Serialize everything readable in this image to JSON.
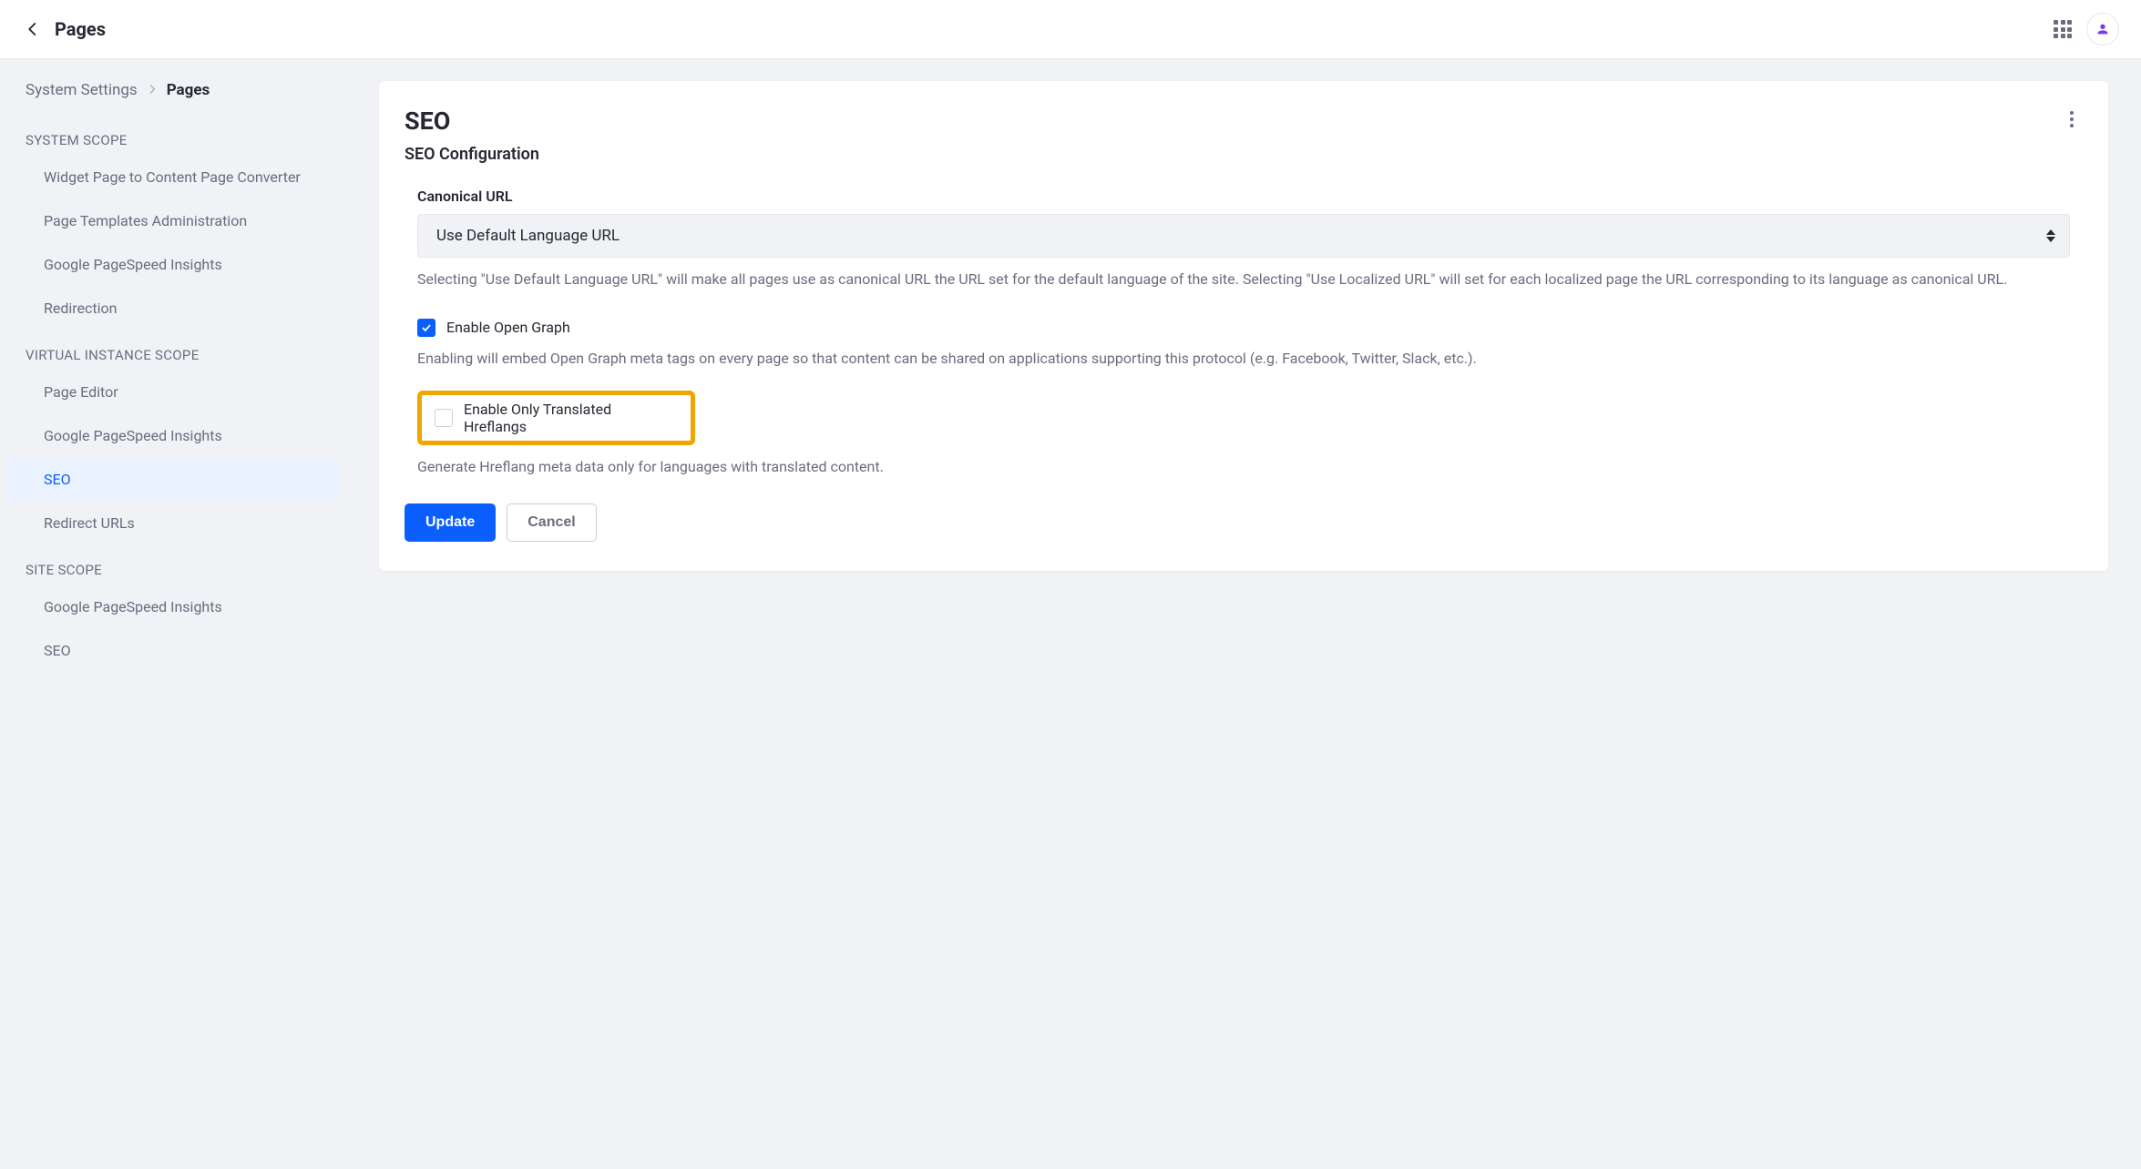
{
  "topbar": {
    "title": "Pages"
  },
  "breadcrumb": {
    "parent": "System Settings",
    "current": "Pages"
  },
  "sidebar": {
    "scopes": [
      {
        "label": "SYSTEM SCOPE",
        "items": [
          {
            "label": "Widget Page to Content Page Converter"
          },
          {
            "label": "Page Templates Administration"
          },
          {
            "label": "Google PageSpeed Insights"
          },
          {
            "label": "Redirection"
          }
        ]
      },
      {
        "label": "VIRTUAL INSTANCE SCOPE",
        "items": [
          {
            "label": "Page Editor"
          },
          {
            "label": "Google PageSpeed Insights"
          },
          {
            "label": "SEO",
            "active": true
          },
          {
            "label": "Redirect URLs"
          }
        ]
      },
      {
        "label": "SITE SCOPE",
        "items": [
          {
            "label": "Google PageSpeed Insights"
          },
          {
            "label": "SEO"
          }
        ]
      }
    ]
  },
  "panel": {
    "title": "SEO",
    "subtitle": "SEO Configuration",
    "canonical": {
      "label": "Canonical URL",
      "value": "Use Default Language URL",
      "help": "Selecting \"Use Default Language URL\" will make all pages use as canonical URL the URL set for the default language of the site. Selecting \"Use Localized URL\" will set for each localized page the URL corresponding to its language as canonical URL."
    },
    "openGraph": {
      "label": "Enable Open Graph",
      "checked": true,
      "help": "Enabling will embed Open Graph meta tags on every page so that content can be shared on applications supporting this protocol (e.g. Facebook, Twitter, Slack, etc.)."
    },
    "hreflang": {
      "label": "Enable Only Translated Hreflangs",
      "checked": false,
      "help": "Generate Hreflang meta data only for languages with translated content."
    },
    "buttons": {
      "update": "Update",
      "cancel": "Cancel"
    }
  }
}
